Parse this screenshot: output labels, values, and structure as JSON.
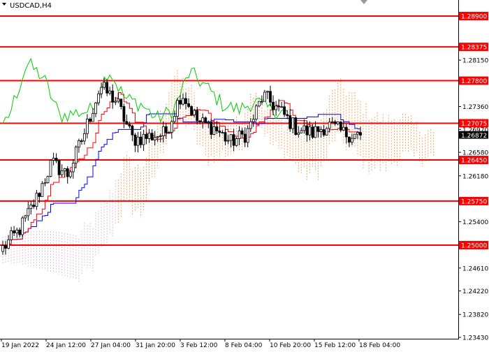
{
  "window": {
    "title": "USDCAD,H4",
    "menu_icon": "triangle-down-icon",
    "scroll_marker_icon": "triangle-down-icon"
  },
  "colors": {
    "background": "#ffffff",
    "frame": "#000000",
    "level_line": "#ff0000",
    "level_label_bg": "#ff0000",
    "level_label_text": "#ffffff",
    "current_price_bg": "#000000",
    "current_price_text": "#ffffff",
    "candle": "#000000",
    "tenkan_sen": "#ff0000",
    "kijun_sen": "#0000ff",
    "chikou_span": "#00cc00",
    "cloud_bullish": "#f4a460",
    "cloud_bearish": "#d8bfd8"
  },
  "chart_data": {
    "type": "candlestick",
    "symbol": "USDCAD",
    "timeframe": "H4",
    "ylim": [
      1.2332,
      1.2915
    ],
    "price_axis_ticks": [
      "1.28150",
      "1.27360",
      "1.26970",
      "1.26580",
      "1.26180",
      "1.25400",
      "1.25010",
      "1.24610",
      "1.24220",
      "1.23820",
      "1.23430"
    ],
    "time_axis_labels": [
      "19 Jan 2022",
      "24 Jan 12:00",
      "27 Jan 04:00",
      "31 Jan 20:00",
      "3 Feb 12:00",
      "8 Feb 04:00",
      "10 Feb 20:00",
      "15 Feb 12:00",
      "18 Feb 04:00"
    ],
    "horizontal_levels": [
      {
        "label": "1.28900",
        "value": 1.289
      },
      {
        "label": "1.28375",
        "value": 1.28375
      },
      {
        "label": "1.27800",
        "value": 1.278
      },
      {
        "label": "1.27075",
        "value": 1.27075
      },
      {
        "label": "1.26450",
        "value": 1.2645
      },
      {
        "label": "1.25750",
        "value": 1.2575
      },
      {
        "label": "1.25000",
        "value": 1.25
      }
    ],
    "current_price": {
      "label": "1.26872",
      "value": 1.26872
    },
    "candles_close_approx": [
      {
        "date": "19 Jan",
        "close": 1.2495
      },
      {
        "date": "20 Jan",
        "close": 1.2525
      },
      {
        "date": "21 Jan",
        "close": 1.2575
      },
      {
        "date": "24 Jan",
        "close": 1.264
      },
      {
        "date": "25 Jan",
        "close": 1.262
      },
      {
        "date": "26 Jan",
        "close": 1.269
      },
      {
        "date": "27 Jan",
        "close": 1.277
      },
      {
        "date": "28 Jan",
        "close": 1.2745
      },
      {
        "date": "31 Jan",
        "close": 1.268
      },
      {
        "date": "1 Feb",
        "close": 1.2685
      },
      {
        "date": "2 Feb",
        "close": 1.269
      },
      {
        "date": "3 Feb",
        "close": 1.276
      },
      {
        "date": "4 Feb",
        "close": 1.271
      },
      {
        "date": "7 Feb",
        "close": 1.27
      },
      {
        "date": "8 Feb",
        "close": 1.2675
      },
      {
        "date": "9 Feb",
        "close": 1.269
      },
      {
        "date": "10 Feb",
        "close": 1.2755
      },
      {
        "date": "11 Feb",
        "close": 1.273
      },
      {
        "date": "14 Feb",
        "close": 1.27
      },
      {
        "date": "15 Feb",
        "close": 1.269
      },
      {
        "date": "16 Feb",
        "close": 1.2705
      },
      {
        "date": "17 Feb",
        "close": 1.269
      },
      {
        "date": "18 Feb",
        "close": 1.26872
      }
    ],
    "grid": false
  }
}
